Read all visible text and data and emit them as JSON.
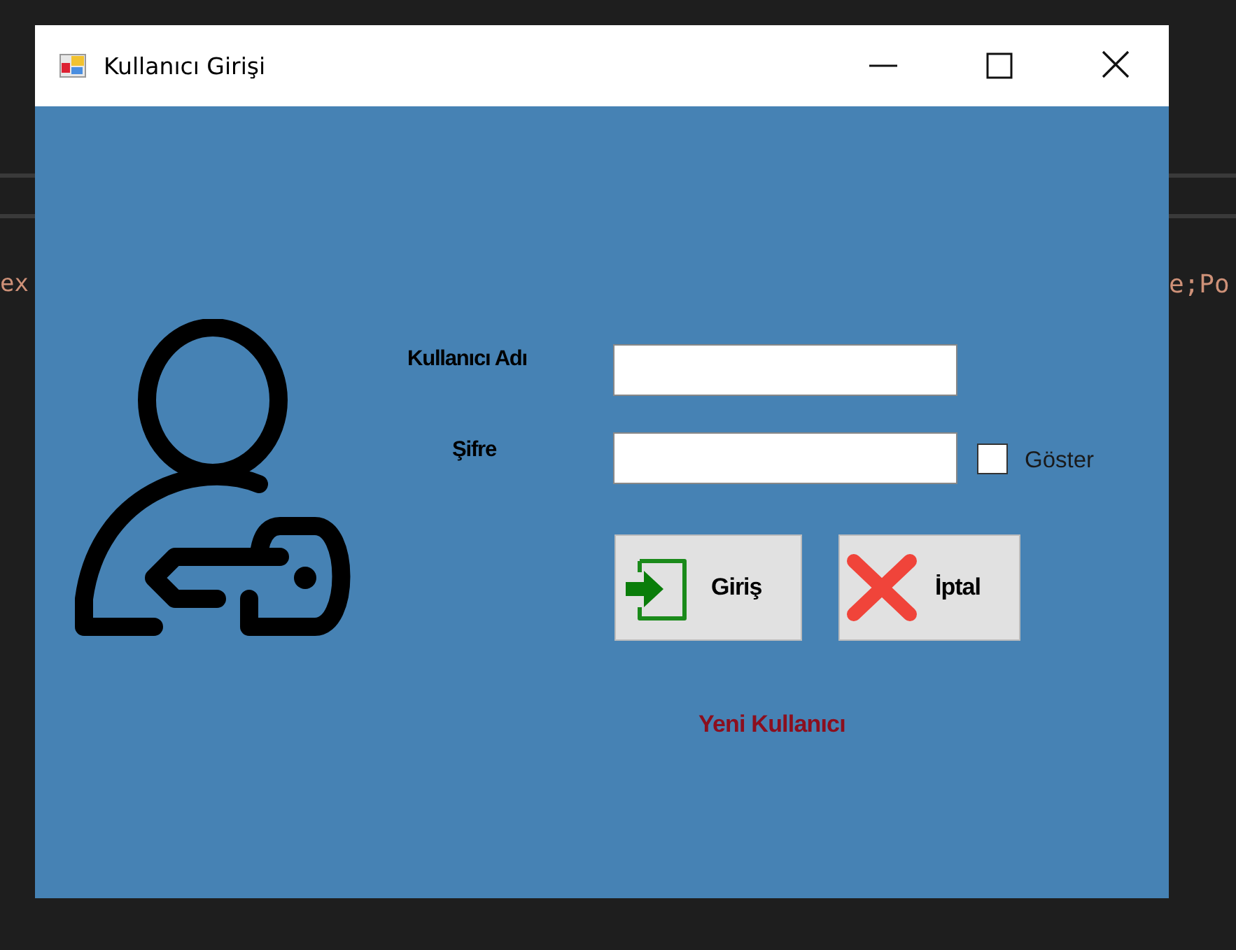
{
  "editor": {
    "left_text": "ex",
    "right_text": "e;Po"
  },
  "window": {
    "title": "Kullanıcı Girişi"
  },
  "form": {
    "fields": [
      {
        "label": "Kullanıcı Adı",
        "kind": "text"
      },
      {
        "label": "Şifre",
        "kind": "password"
      }
    ],
    "show_password": {
      "label": "Göster",
      "checked": false
    },
    "buttons": [
      {
        "label": "Giriş",
        "kind": "login"
      },
      {
        "label": "İptal",
        "kind": "cancel"
      }
    ],
    "link": "Yeni Kullanıcı"
  }
}
